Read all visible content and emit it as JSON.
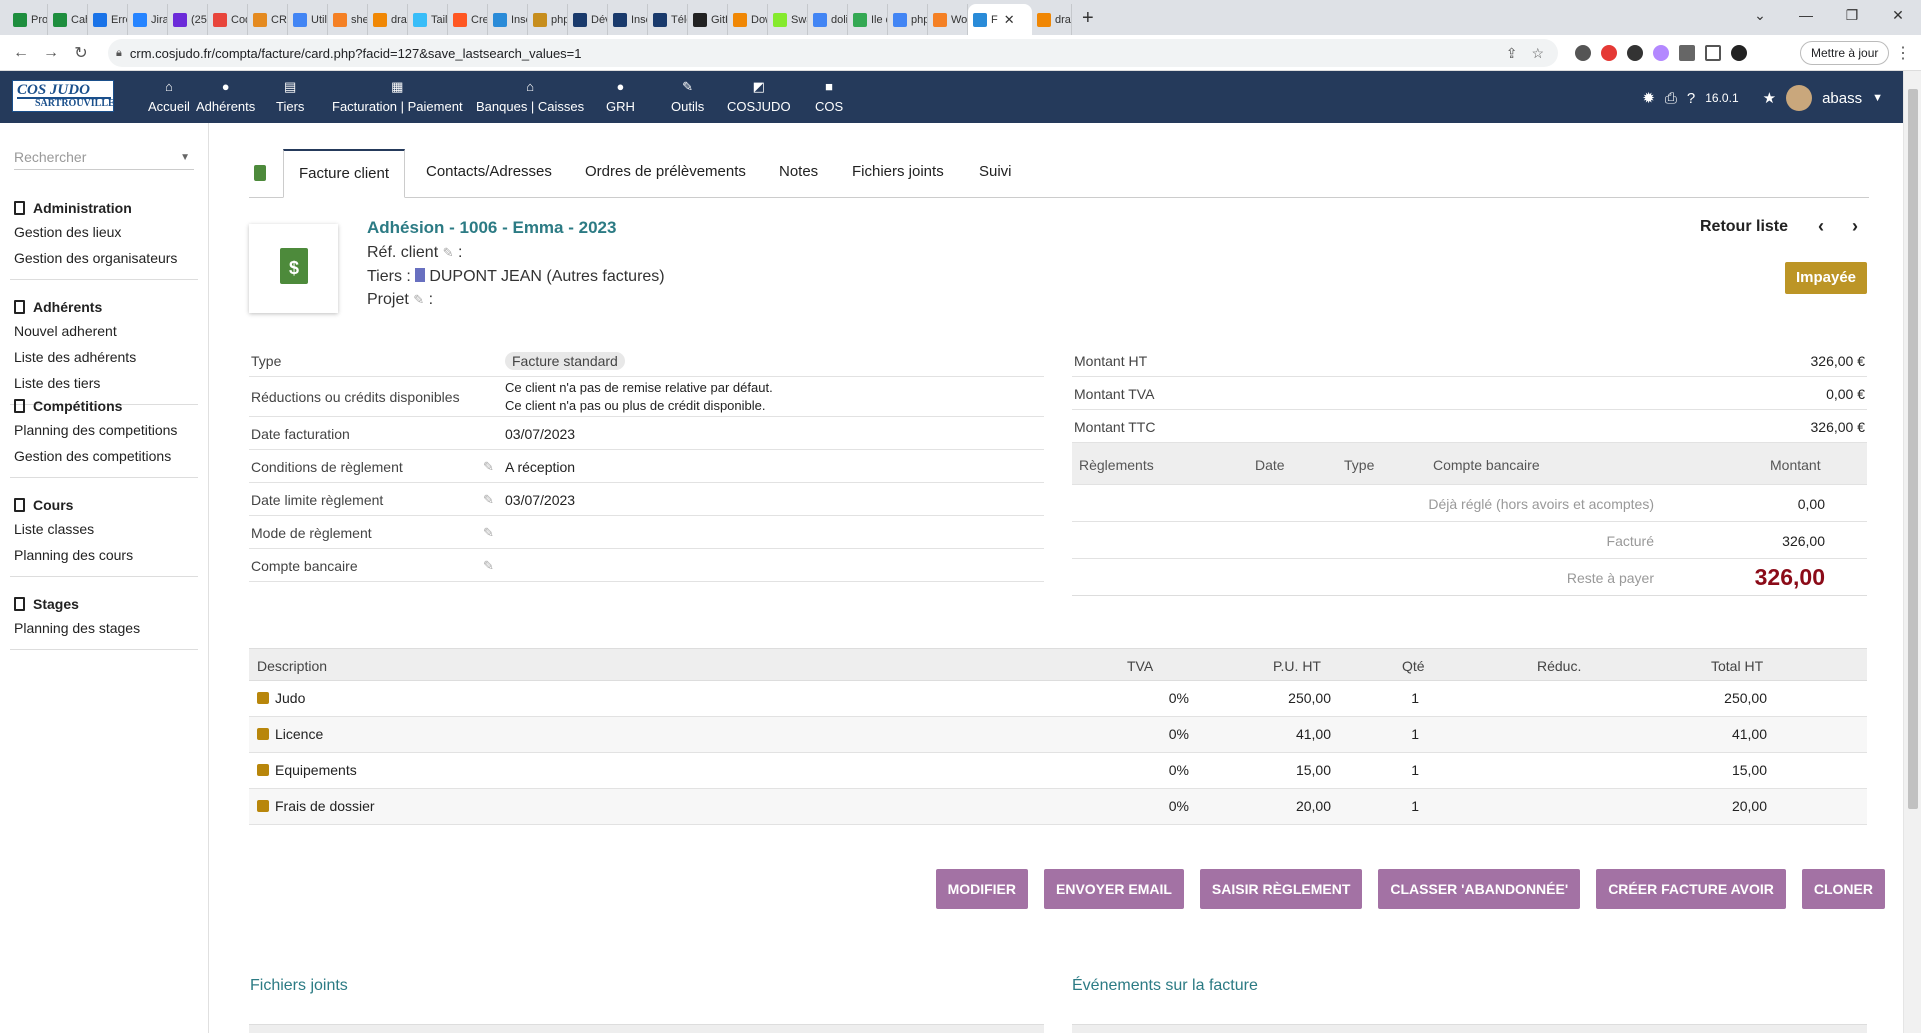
{
  "browser": {
    "tabs": [
      {
        "title": "Proj",
        "color": "#1e8e3e"
      },
      {
        "title": "Cah",
        "color": "#1e8e3e"
      },
      {
        "title": "Erre",
        "color": "#1a73e8"
      },
      {
        "title": "Jira",
        "color": "#2684ff"
      },
      {
        "title": "(25",
        "color": "#6c2bd9"
      },
      {
        "title": "Cod",
        "color": "#e8453c"
      },
      {
        "title": "CRM",
        "color": "#e48a20"
      },
      {
        "title": "Utili",
        "color": "#4285f4"
      },
      {
        "title": "sher",
        "color": "#f48024"
      },
      {
        "title": "draw",
        "color": "#f08705"
      },
      {
        "title": "Tailw",
        "color": "#38bdf8"
      },
      {
        "title": "Crea",
        "color": "#ff5722"
      },
      {
        "title": "Insc",
        "color": "#2a8bd8"
      },
      {
        "title": "php",
        "color": "#c78e1e"
      },
      {
        "title": "Dév",
        "color": "#1a3a6c"
      },
      {
        "title": "Insc",
        "color": "#1a3a6c"
      },
      {
        "title": "Télé",
        "color": "#1a3a6c"
      },
      {
        "title": "GitH",
        "color": "#222222"
      },
      {
        "title": "Dow",
        "color": "#f08705"
      },
      {
        "title": "Swa",
        "color": "#85ea2d"
      },
      {
        "title": "dolil",
        "color": "#4285f4"
      },
      {
        "title": "Ile d",
        "color": "#34a853"
      },
      {
        "title": "php",
        "color": "#4285f4"
      },
      {
        "title": "Wor",
        "color": "#f48024"
      },
      {
        "title": "F",
        "color": "#2a8bd8"
      },
      {
        "title": "draw",
        "color": "#f08705"
      }
    ],
    "url": "crm.cosjudo.fr/compta/facture/card.php?facid=127&save_lastsearch_values=1",
    "update_label": "Mettre à jour"
  },
  "app": {
    "logo_line1": "COS JUDO",
    "logo_line2": "SARTROUVILLE",
    "menu": [
      {
        "label": "Accueil",
        "icon": "⌂"
      },
      {
        "label": "Adhérents",
        "icon": "●"
      },
      {
        "label": "Tiers",
        "icon": "▤"
      },
      {
        "label": "Facturation | Paiement",
        "icon": "▦"
      },
      {
        "label": "Banques | Caisses",
        "icon": "⌂"
      },
      {
        "label": "GRH",
        "icon": "●"
      },
      {
        "label": "Outils",
        "icon": "✎"
      },
      {
        "label": "COSJUDO",
        "icon": "◩"
      },
      {
        "label": "COS",
        "icon": "■"
      }
    ],
    "version": "16.0.1",
    "user": "abass"
  },
  "sidebar": {
    "search_placeholder": "Rechercher",
    "sections": [
      {
        "title": "Administration",
        "items": [
          "Gestion des lieux",
          "Gestion des organisateurs"
        ]
      },
      {
        "title": "Adhérents",
        "items": [
          "Nouvel adherent",
          "Liste des adhérents",
          "Liste des tiers"
        ]
      },
      {
        "title": "Compétitions",
        "items": [
          "Planning des competitions",
          "Gestion des competitions"
        ]
      },
      {
        "title": "Cours",
        "items": [
          "Liste classes",
          "Planning des cours"
        ]
      },
      {
        "title": "Stages",
        "items": [
          "Planning des stages"
        ]
      }
    ]
  },
  "tabs": [
    "Facture client",
    "Contacts/Adresses",
    "Ordres de prélèvements",
    "Notes",
    "Fichiers joints",
    "Suivi"
  ],
  "invoice": {
    "title": "Adhésion - 1006 - Emma - 2023",
    "ref_client_label": "Réf. client",
    "tiers_label": "Tiers :",
    "tiers_value": "DUPONT JEAN (Autres factures)",
    "projet_label": "Projet",
    "back_label": "Retour liste",
    "status": "Impayée"
  },
  "fields": {
    "type_label": "Type",
    "type_value": "Facture standard",
    "reductions_label": "Réductions ou crédits disponibles",
    "reductions_line1": "Ce client n'a pas de remise relative par défaut.",
    "reductions_line2": "Ce client n'a pas ou plus de crédit disponible.",
    "date_label": "Date facturation",
    "date_value": "03/07/2023",
    "conditions_label": "Conditions de règlement",
    "conditions_value": "A réception",
    "limite_label": "Date limite règlement",
    "limite_value": "03/07/2023",
    "mode_label": "Mode de règlement",
    "compte_label": "Compte bancaire"
  },
  "amounts": {
    "ht_label": "Montant HT",
    "ht_value": "326,00 €",
    "tva_label": "Montant TVA",
    "tva_value": "0,00 €",
    "ttc_label": "Montant TTC",
    "ttc_value": "326,00 €",
    "pay_headers": [
      "Règlements",
      "Date",
      "Type",
      "Compte bancaire",
      "Montant"
    ],
    "deja_label": "Déjà réglé (hors avoirs et acomptes)",
    "deja_value": "0,00",
    "facture_label": "Facturé",
    "facture_value": "326,00",
    "reste_label": "Reste à payer",
    "reste_value": "326,00"
  },
  "lines": {
    "headers": [
      "Description",
      "TVA",
      "P.U. HT",
      "Qté",
      "Réduc.",
      "Total HT"
    ],
    "rows": [
      {
        "desc": "Judo",
        "tva": "0%",
        "pu": "250,00",
        "qty": "1",
        "reduc": "",
        "total": "250,00"
      },
      {
        "desc": "Licence",
        "tva": "0%",
        "pu": "41,00",
        "qty": "1",
        "reduc": "",
        "total": "41,00"
      },
      {
        "desc": "Equipements",
        "tva": "0%",
        "pu": "15,00",
        "qty": "1",
        "reduc": "",
        "total": "15,00"
      },
      {
        "desc": "Frais de dossier",
        "tva": "0%",
        "pu": "20,00",
        "qty": "1",
        "reduc": "",
        "total": "20,00"
      }
    ]
  },
  "actions": [
    "MODIFIER",
    "ENVOYER EMAIL",
    "SAISIR RÈGLEMENT",
    "CLASSER 'ABANDONNÉE'",
    "CRÉER FACTURE AVOIR",
    "CLONER"
  ],
  "bottom": {
    "files_title": "Fichiers joints",
    "events_title": "Événements sur la facture"
  }
}
